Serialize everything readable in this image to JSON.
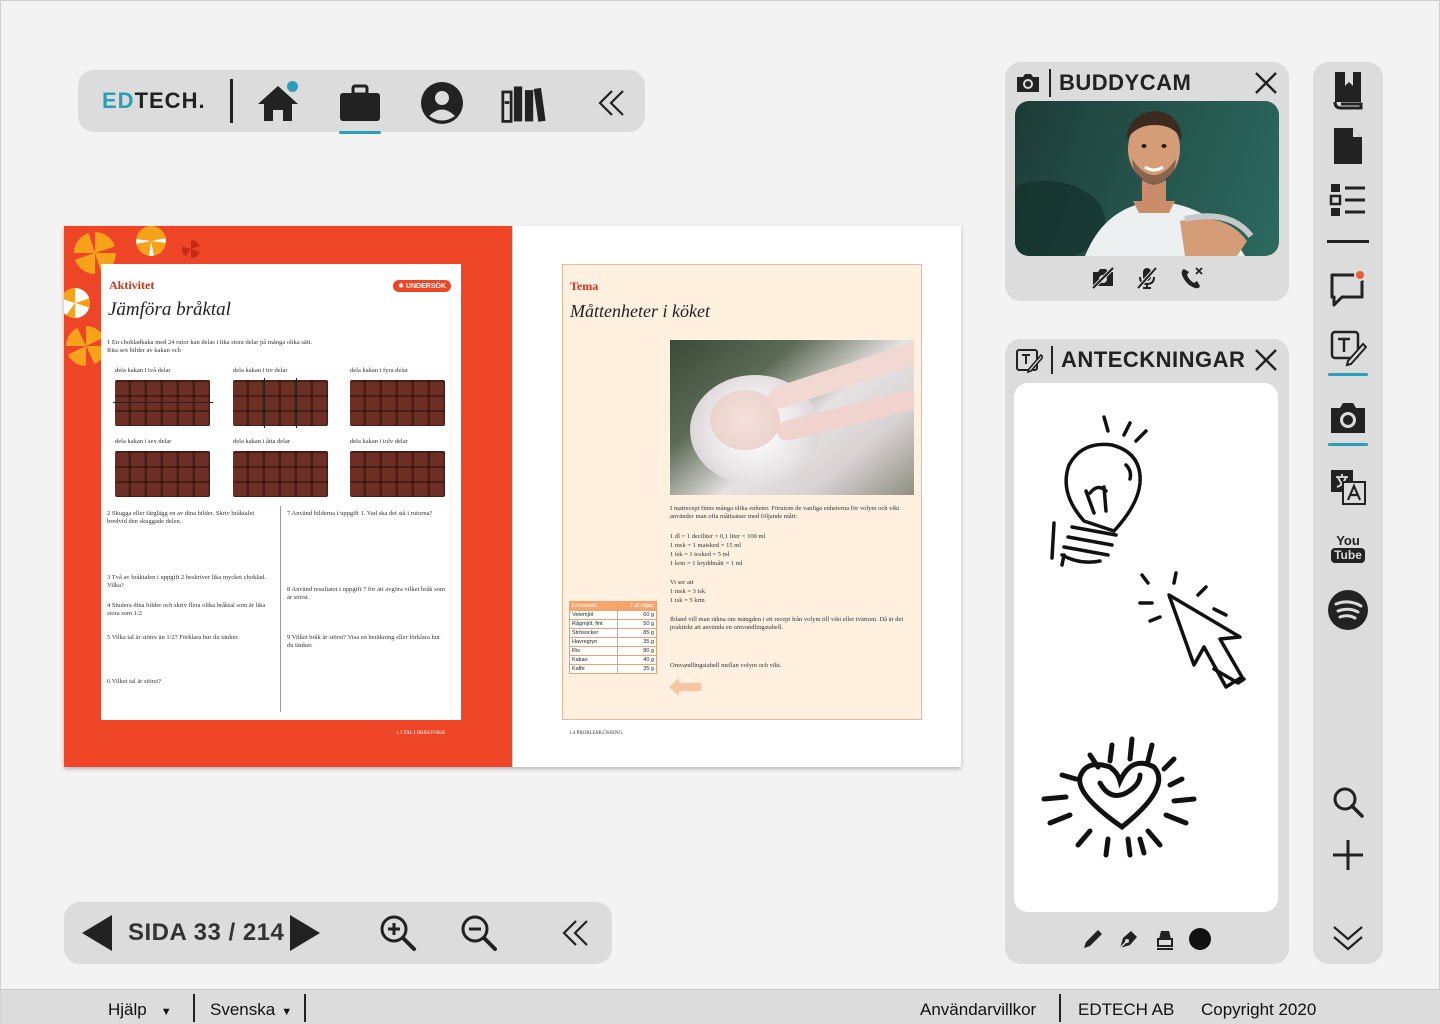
{
  "topnav": {
    "brand_accent": "ED",
    "brand_rest": "TECH.",
    "items": [
      "home-icon",
      "briefcase-icon",
      "user-icon",
      "library-icon",
      "collapse-icon"
    ]
  },
  "book": {
    "left": {
      "kicker": "Aktivitet",
      "badge": "✱ UNDERSÖK",
      "title": "Jämföra bråktal",
      "q1": "1  En chokladkaka med 24 rutor kan delas i lika stora delar på många olika sätt. Rita sex bilder av kakan och",
      "bars": [
        "dela kakan i två delar",
        "dela kakan i tre delar",
        "dela kakan i fyra delar",
        "dela kakan i sex delar",
        "dela kakan i åtta delar",
        "dela kakan i tolv delar"
      ],
      "q2": "2  Skugga eller färglägg en av dina bilder. Skriv bråktalet bredvid den skuggade delen.",
      "q3": "3  Två av bråktalen i uppgift 2 beskriver lika mycket choklad. Vilka?",
      "q4": "4  Studera dina bilder och skriv flera olika bråktal som är lika stora som 1/2",
      "q5": "5  Vilka tal är större än 1/2? Förklara hur du tänker.",
      "q6": "6  Vilket tal är störst?",
      "q7": "7  Använd bilderna i uppgift 1. Vad ska det stå i rutorna?",
      "q8": "8  Använd resultatet i uppgift 7 för att avgöra vilket bråk som är störst.",
      "q9": "9  Vilket bråk är störst? Visa en beräkning eller förklara hur du tänker.",
      "footer": "1.3  TAL I BRÅKFORM"
    },
    "right": {
      "kicker": "Tema",
      "title": "Måttenheter i köket",
      "intro": "I matrecept finns många olika enheter. Förutom de vanliga enheterna för volym och vikt använder man ofta måttsatser med följande mått:",
      "units": [
        "1 dl = 1 deciliter = 0,1 liter = 100 ml",
        "1 msk = 1 matsked = 15 ml",
        "1 tsk = 1 tesked = 5 ml",
        "1 krm = 1 kryddmått = 1 ml"
      ],
      "we_see": "Vi ser att",
      "we_see_lines": [
        "1 msk = 3 tsk",
        "1 tsk = 5 krm"
      ],
      "conversion": "Ibland vill man räkna om mängden i ett recept från volym till vikt eller tvärtom. Då är det praktiskt att använda en omvandlingstabell.",
      "table_caption": "Omvandlingstabell mellan volym och vikt.",
      "table_header": [
        "Livsmedel",
        "1 dl väger"
      ],
      "table_rows": [
        [
          "Vetemjöl",
          "60 g"
        ],
        [
          "Rågmjöl, fint",
          "50 g"
        ],
        [
          "Strösocker",
          "85 g"
        ],
        [
          "Havregryn",
          "35 g"
        ],
        [
          "Ris",
          "80 g"
        ],
        [
          "Kakao",
          "40 g"
        ],
        [
          "Kaffe",
          "35 g"
        ]
      ],
      "footer": "1.4  PROBLEMLÖSNING"
    }
  },
  "buddycam": {
    "title": "BUDDYCAM",
    "controls": [
      "camera-off-icon",
      "mic-off-icon",
      "end-call-icon"
    ]
  },
  "notes": {
    "title": "ANTECKNINGAR",
    "tools": [
      "pencil-icon",
      "pen-icon",
      "highlighter-icon",
      "color-dot-icon"
    ]
  },
  "sidebar": {
    "items": [
      "bookmark-book-icon",
      "document-icon",
      "list-icon",
      "chat-icon",
      "notes-icon",
      "camera-icon",
      "translate-icon",
      "youtube-icon",
      "spotify-icon",
      "search-icon",
      "plus-icon",
      "expand-down-icon"
    ],
    "youtube_top": "You",
    "youtube_bottom": "Tube"
  },
  "pager": {
    "label": "SIDA 33 / 214"
  },
  "footer": {
    "help": "Hjälp",
    "language": "Svenska",
    "terms": "Användarvillkor",
    "company": "EDTECH AB",
    "copyright": "Copyright 2020"
  },
  "colors": {
    "accent": "#2a9fb8",
    "book_red": "#ee4527",
    "notification": "#f05a3a"
  }
}
